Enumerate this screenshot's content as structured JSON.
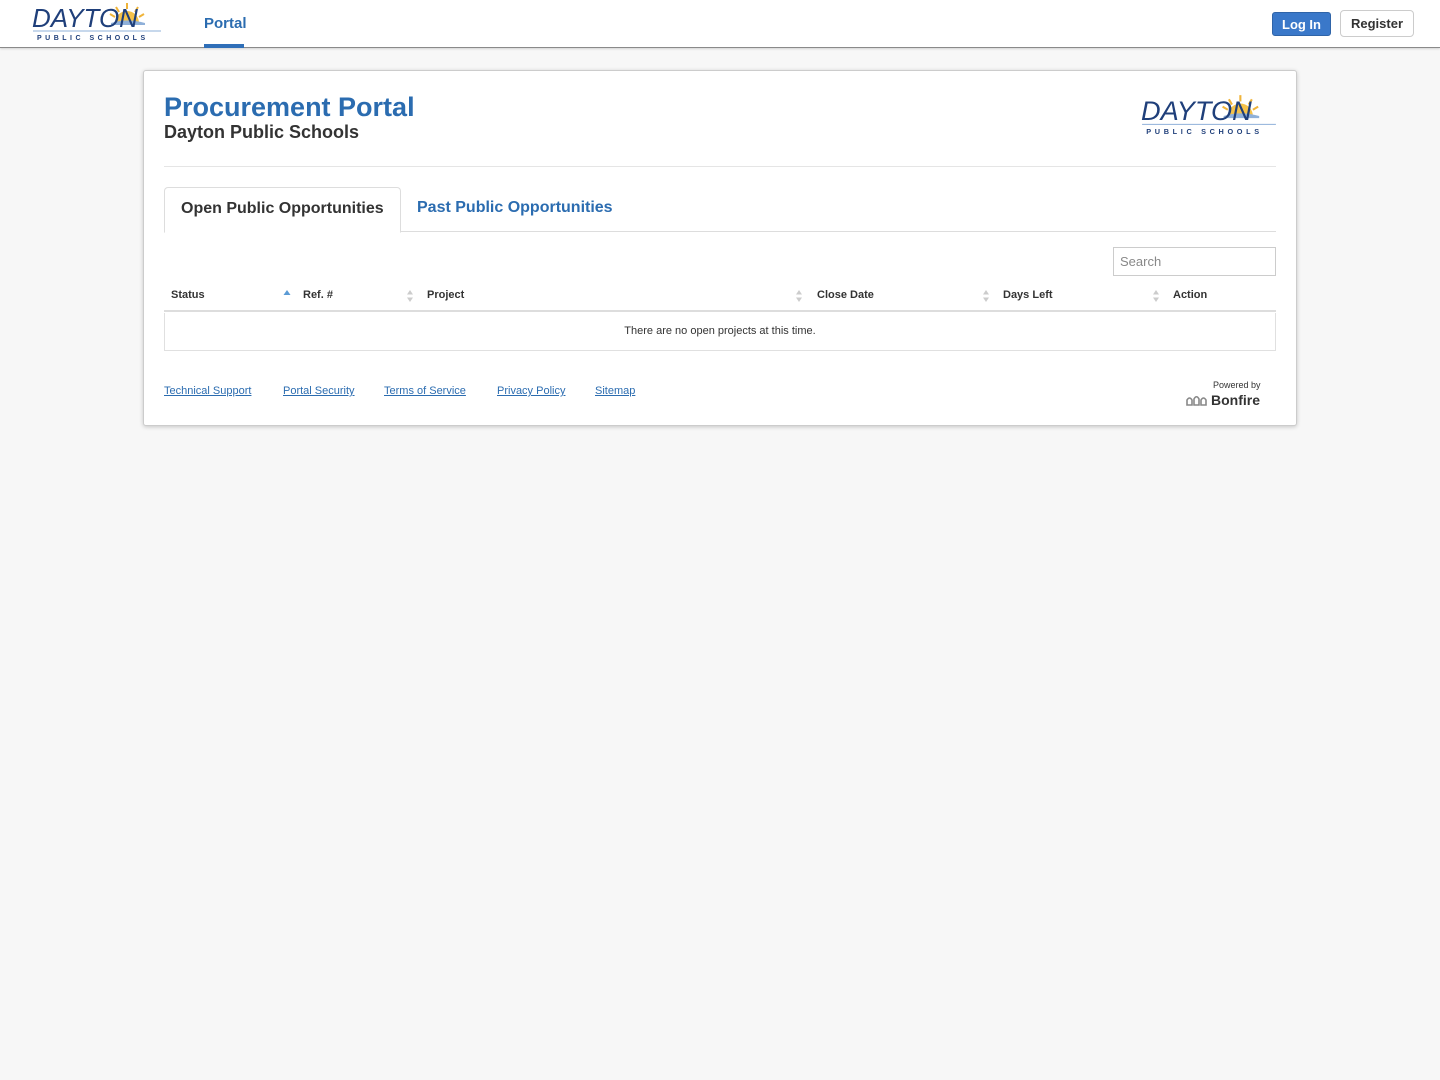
{
  "header": {
    "logo_text": "DAYTON",
    "logo_subtext": "PUBLIC SCHOOLS",
    "nav": [
      {
        "label": "Portal",
        "active": true
      }
    ],
    "login_label": "Log In",
    "register_label": "Register"
  },
  "page": {
    "title": "Procurement Portal",
    "subtitle": "Dayton Public Schools",
    "tabs": [
      {
        "label": "Open Public Opportunities",
        "active": true
      },
      {
        "label": "Past Public Opportunities",
        "active": false
      }
    ],
    "search": {
      "placeholder": "Search",
      "value": ""
    },
    "table": {
      "columns": [
        {
          "label": "Status",
          "sort": "ascending"
        },
        {
          "label": "Ref. #",
          "sort": "none"
        },
        {
          "label": "Project",
          "sort": "none"
        },
        {
          "label": "Close Date",
          "sort": "none"
        },
        {
          "label": "Days Left",
          "sort": "none"
        },
        {
          "label": "Action",
          "sort": "none"
        }
      ],
      "rows": [],
      "empty_message": "There are no open projects at this time."
    },
    "footer": {
      "links": [
        "Technical Support",
        "Portal Security",
        "Terms of Service",
        "Privacy Policy",
        "Sitemap"
      ],
      "powered_by": "Powered by",
      "brand": "Bonfire"
    }
  },
  "colors": {
    "accent": "#2b6cb0",
    "button_primary": "#3a78c9",
    "background": "#f7f7f7",
    "logo_navy": "#1f3f7a",
    "logo_sun": "#f0b43a"
  }
}
